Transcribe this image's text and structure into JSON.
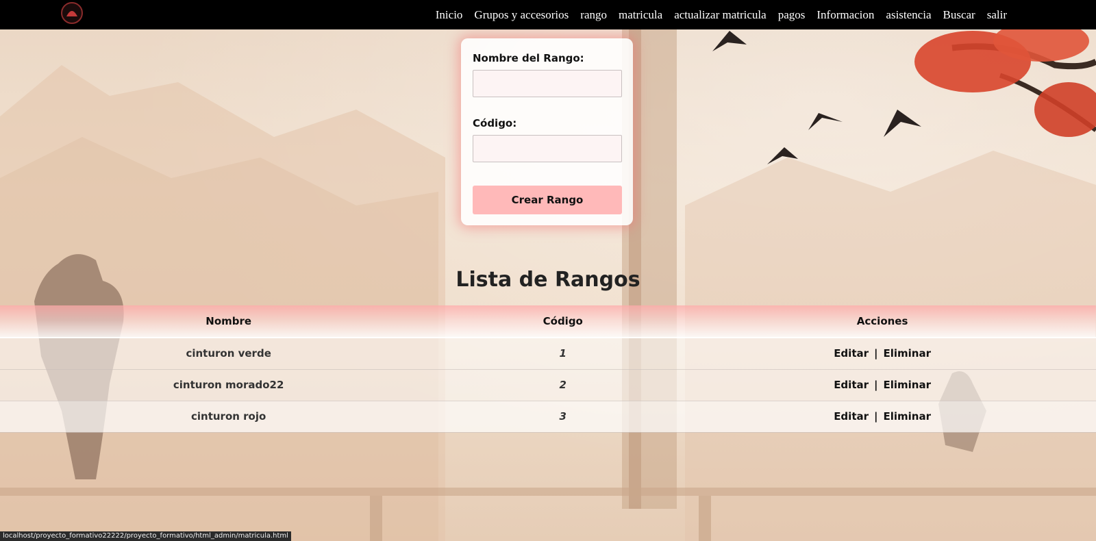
{
  "nav": {
    "logo_icon": "dojo-logo-icon",
    "links": [
      "Inicio",
      "Grupos y accesorios",
      "rango",
      "matricula",
      "actualizar matricula",
      "pagos",
      "Informacion",
      "asistencia",
      "Buscar",
      "salir"
    ]
  },
  "form": {
    "name_label": "Nombre del Rango:",
    "name_value": "",
    "code_label": "Código:",
    "code_value": "",
    "submit_label": "Crear Rango"
  },
  "list": {
    "title": "Lista de Rangos",
    "headers": [
      "Nombre",
      "Código",
      "Acciones"
    ],
    "rows": [
      {
        "nombre": "cinturon verde",
        "codigo": "1",
        "edit": "Editar",
        "sep": "|",
        "delete": "Eliminar"
      },
      {
        "nombre": "cinturon morado22",
        "codigo": "2",
        "edit": "Editar",
        "sep": "|",
        "delete": "Eliminar"
      },
      {
        "nombre": "cinturon rojo",
        "codigo": "3",
        "edit": "Editar",
        "sep": "|",
        "delete": "Eliminar"
      }
    ]
  },
  "status_bar": {
    "url": "localhost/proyecto_formativo22222/proyecto_formativo/html_admin/matricula.html"
  },
  "colors": {
    "nav_bg": "#000000",
    "button_bg": "#ffb9b9",
    "header_glow": "#f07878",
    "tree_red": "#d8452c"
  }
}
